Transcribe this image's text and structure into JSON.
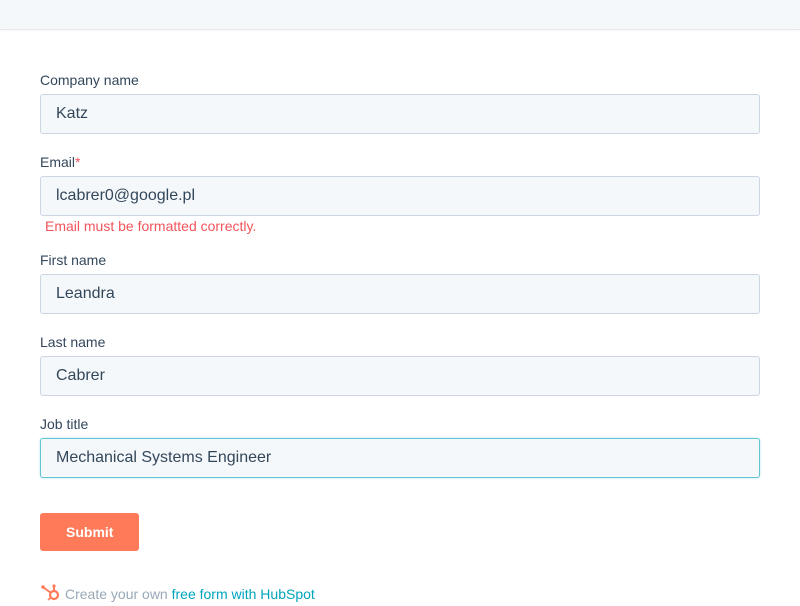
{
  "form": {
    "company": {
      "label": "Company name",
      "value": "Katz"
    },
    "email": {
      "label": "Email",
      "required_mark": "*",
      "value": "lcabrer0@google.pl",
      "error": "Email must be formatted correctly."
    },
    "first_name": {
      "label": "First name",
      "value": "Leandra"
    },
    "last_name": {
      "label": "Last name",
      "value": "Cabrer"
    },
    "job_title": {
      "label": "Job title",
      "value": "Mechanical Systems Engineer"
    },
    "submit_label": "Submit"
  },
  "footer": {
    "prefix": "Create your own ",
    "link_text": "free form with HubSpot",
    "icon": "hubspot-sprocket-icon"
  },
  "colors": {
    "accent": "#ff7a59",
    "error": "#f2545b",
    "link": "#00a4bd",
    "label": "#33475b",
    "input_bg": "#f5f8fa",
    "input_border": "#cbd6e2"
  }
}
